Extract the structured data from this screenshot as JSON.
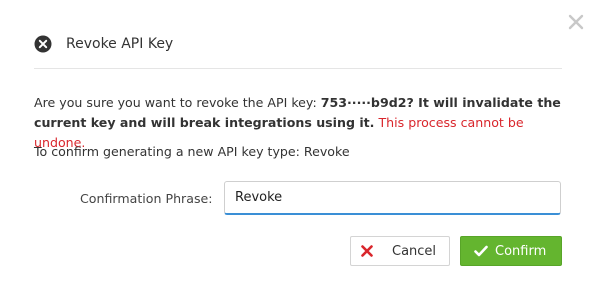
{
  "dialog": {
    "title": "Revoke API Key",
    "warning": {
      "prefix": "Are you sure you want to revoke the API key: ",
      "key": "753·····b9d2?",
      "consequence": " It will invalidate the current key and will break integrations using it.",
      "danger": " This process cannot be undone."
    },
    "confirm_hint": "To confirm generating a new API key type: Revoke",
    "field": {
      "label": "Confirmation Phrase:",
      "value": "Revoke"
    },
    "buttons": {
      "cancel": "Cancel",
      "confirm": "Confirm"
    }
  },
  "icons": {
    "close": "close-icon",
    "header": "circle-x-icon",
    "cancel": "x-icon",
    "confirm": "checkmark-icon"
  },
  "colors": {
    "danger": "#d9262c",
    "confirm_bg": "#64b52f",
    "cancel_icon": "#d9262c",
    "input_focus": "#3a8fd6"
  }
}
